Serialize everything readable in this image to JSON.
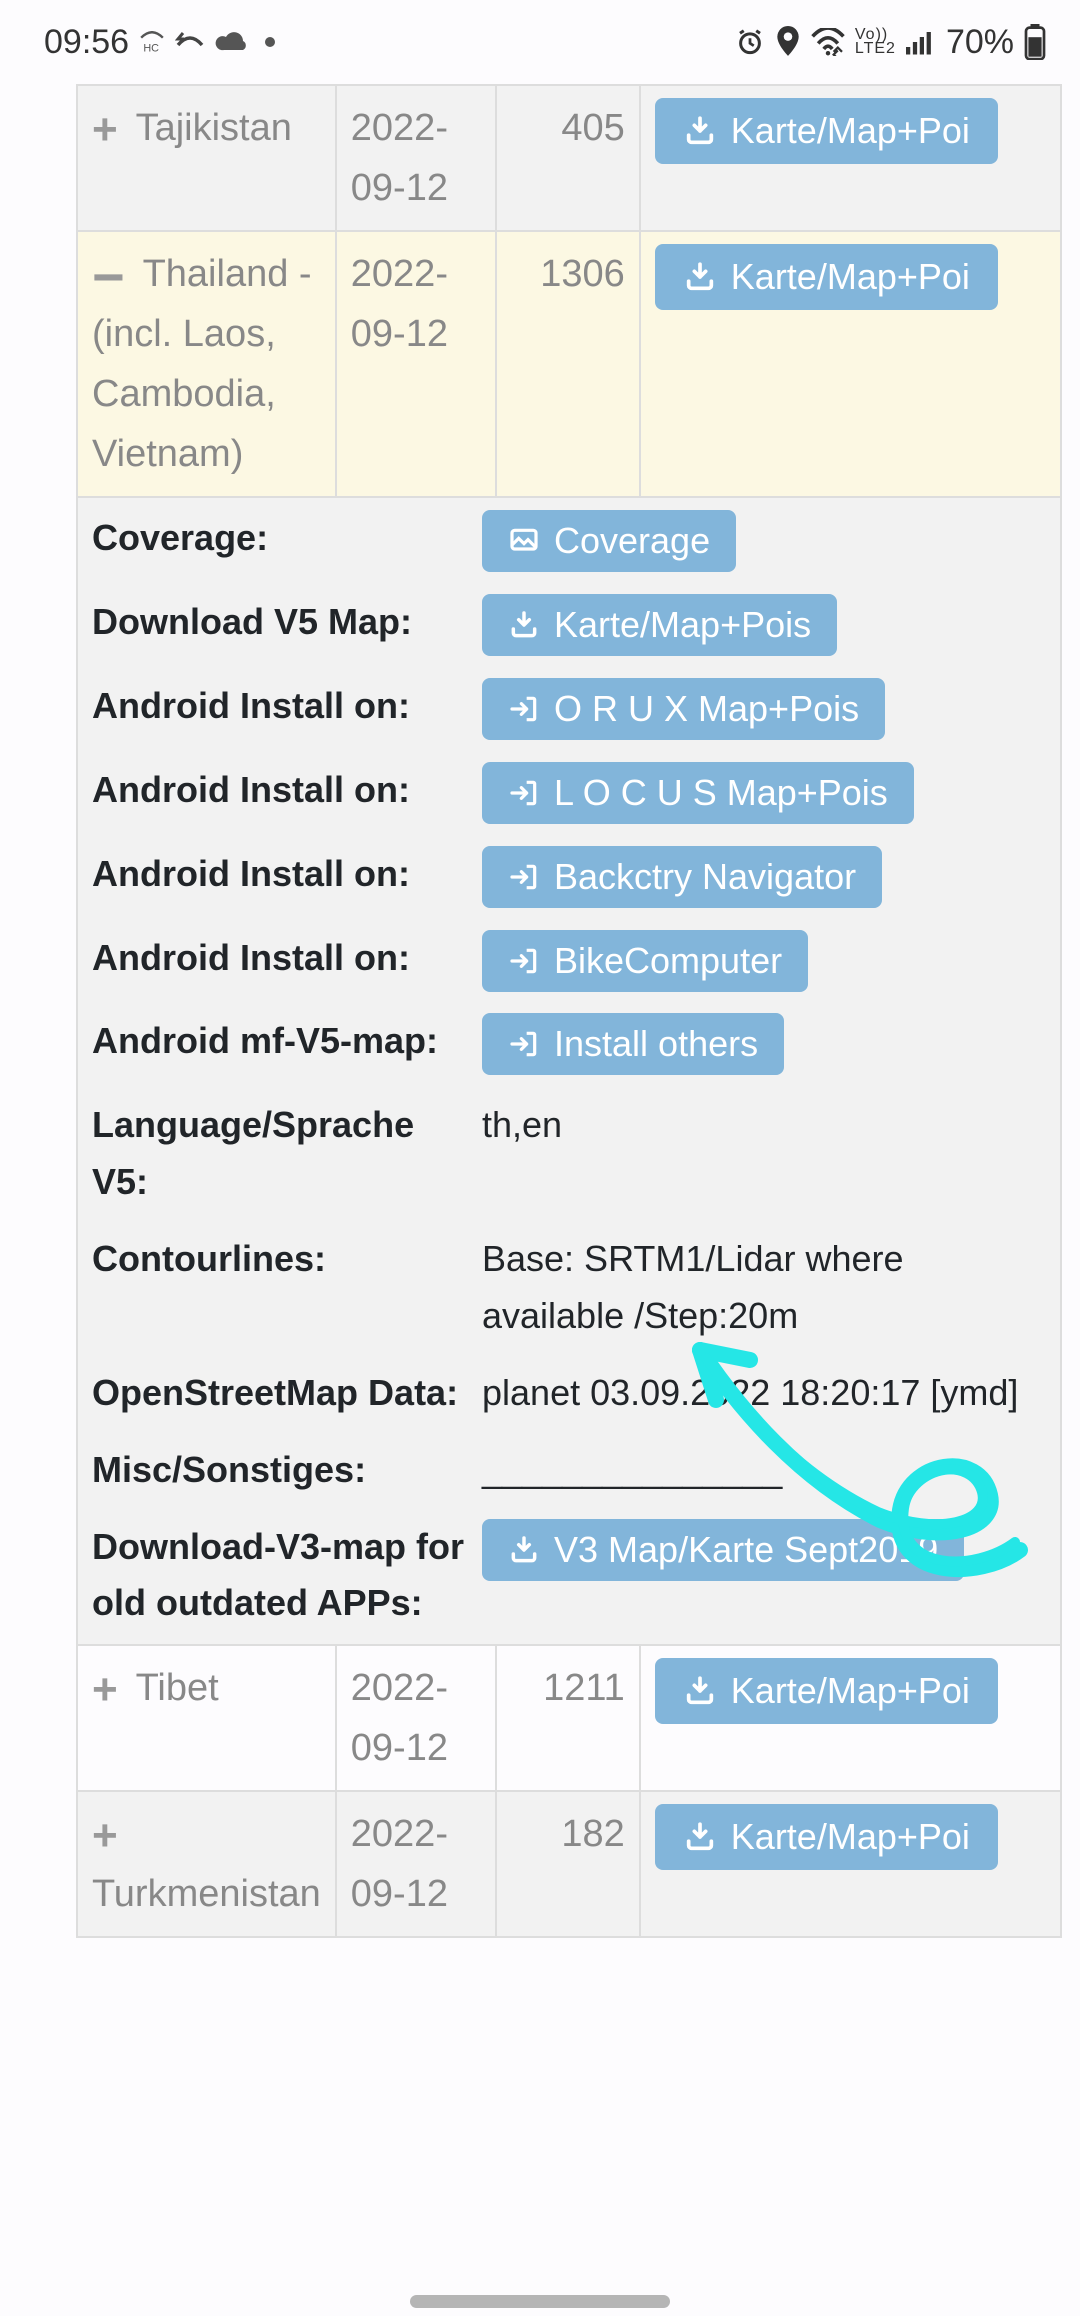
{
  "status": {
    "clock": "09:56",
    "battery_pct": "70%"
  },
  "rows": {
    "tajikistan": {
      "name": "Tajikistan",
      "date": "2022-09-12",
      "size": "405",
      "btn": "Karte/Map+Poi"
    },
    "thailand": {
      "name": "Thailand - (incl. Laos, Cambodia, Vietnam)",
      "date": "2022-09-12",
      "size": "1306",
      "btn": "Karte/Map+Poi"
    },
    "tibet": {
      "name": "Tibet",
      "date": "2022-09-12",
      "size": "1211",
      "btn": "Karte/Map+Poi"
    },
    "turkmenistan": {
      "name": "Turkmenistan",
      "date": "2022-09-12",
      "size": "182",
      "btn": "Karte/Map+Poi"
    }
  },
  "detail": {
    "coverage_label": "Coverage:",
    "coverage_btn": "Coverage",
    "dl_v5_label": "Download V5 Map:",
    "dl_v5_btn": "Karte/Map+Pois",
    "inst1_label": "Android Install on:",
    "inst1_btn": "O R U X   Map+Pois",
    "inst2_label": "Android Install on:",
    "inst2_btn": "L O C U S Map+Pois",
    "inst3_label": "Android Install on:",
    "inst3_btn": "Backctry Navigator",
    "inst4_label": "Android Install on:",
    "inst4_btn": "BikeComputer",
    "inst5_label": "Android mf-V5-map:",
    "inst5_btn": "Install others",
    "lang_label": "Language/Sprache V5:",
    "lang_value": "th,en",
    "contour_label": "Contourlines:",
    "contour_value": "Base: SRTM1/Lidar where available /Step:20m",
    "osm_label": "OpenStreetMap Data:",
    "osm_value": "planet 03.09.2022 18:20:17 [ymd]",
    "misc_label": "Misc/Sonstiges:",
    "misc_value": "_______________",
    "v3_label": "Download-V3-map for old outdated APPs:",
    "v3_btn": "V3 Map/Karte Sept2019"
  }
}
